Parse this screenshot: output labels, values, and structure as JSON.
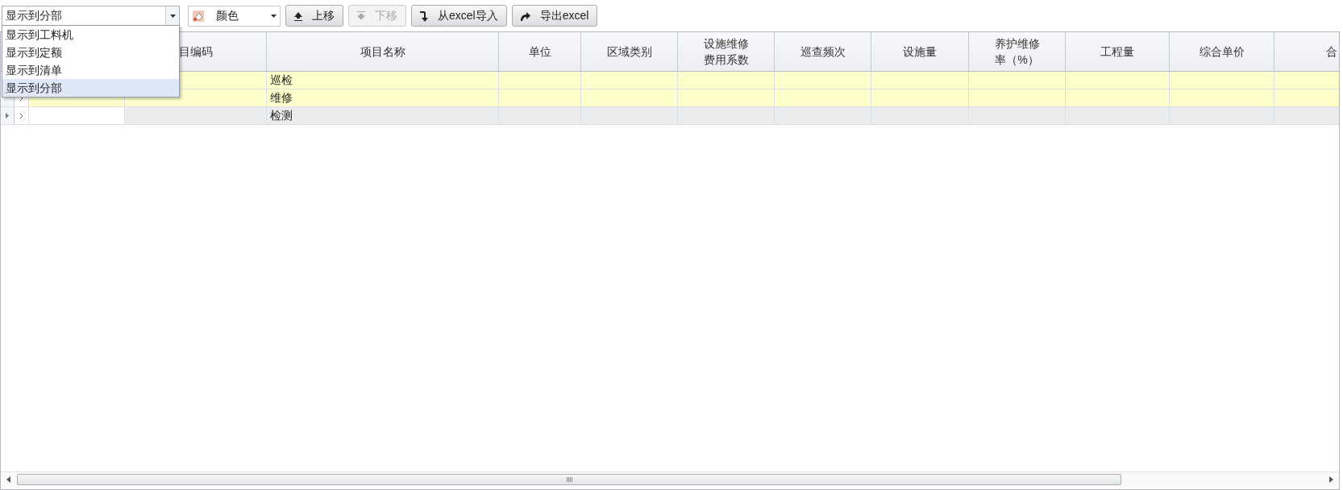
{
  "toolbar": {
    "level_select": {
      "value": "显示到分部",
      "options": [
        {
          "label": "显示到工料机",
          "selected": false
        },
        {
          "label": "显示到定额",
          "selected": false
        },
        {
          "label": "显示到清单",
          "selected": false
        },
        {
          "label": "显示到分部",
          "selected": true
        }
      ]
    },
    "color_picker": {
      "label": "颜色"
    },
    "buttons": [
      {
        "label": "上移",
        "kind": "up",
        "disabled": false
      },
      {
        "label": "下移",
        "kind": "down",
        "disabled": true
      },
      {
        "label": "从excel导入",
        "kind": "import",
        "disabled": false
      },
      {
        "label": "导出excel",
        "kind": "export",
        "disabled": false
      }
    ]
  },
  "table": {
    "columns": [
      "目编码",
      "项目名称",
      "单位",
      "区域类别",
      "设施维修费用系数",
      "巡查频次",
      "设施量",
      "养护维修率（%）",
      "工程量",
      "综合单价",
      "合"
    ],
    "rows": [
      {
        "name": "巡检",
        "highlighted": true,
        "current": false
      },
      {
        "name": "维修",
        "highlighted": true,
        "current": false
      },
      {
        "name": "检测",
        "highlighted": false,
        "current": true
      }
    ]
  }
}
